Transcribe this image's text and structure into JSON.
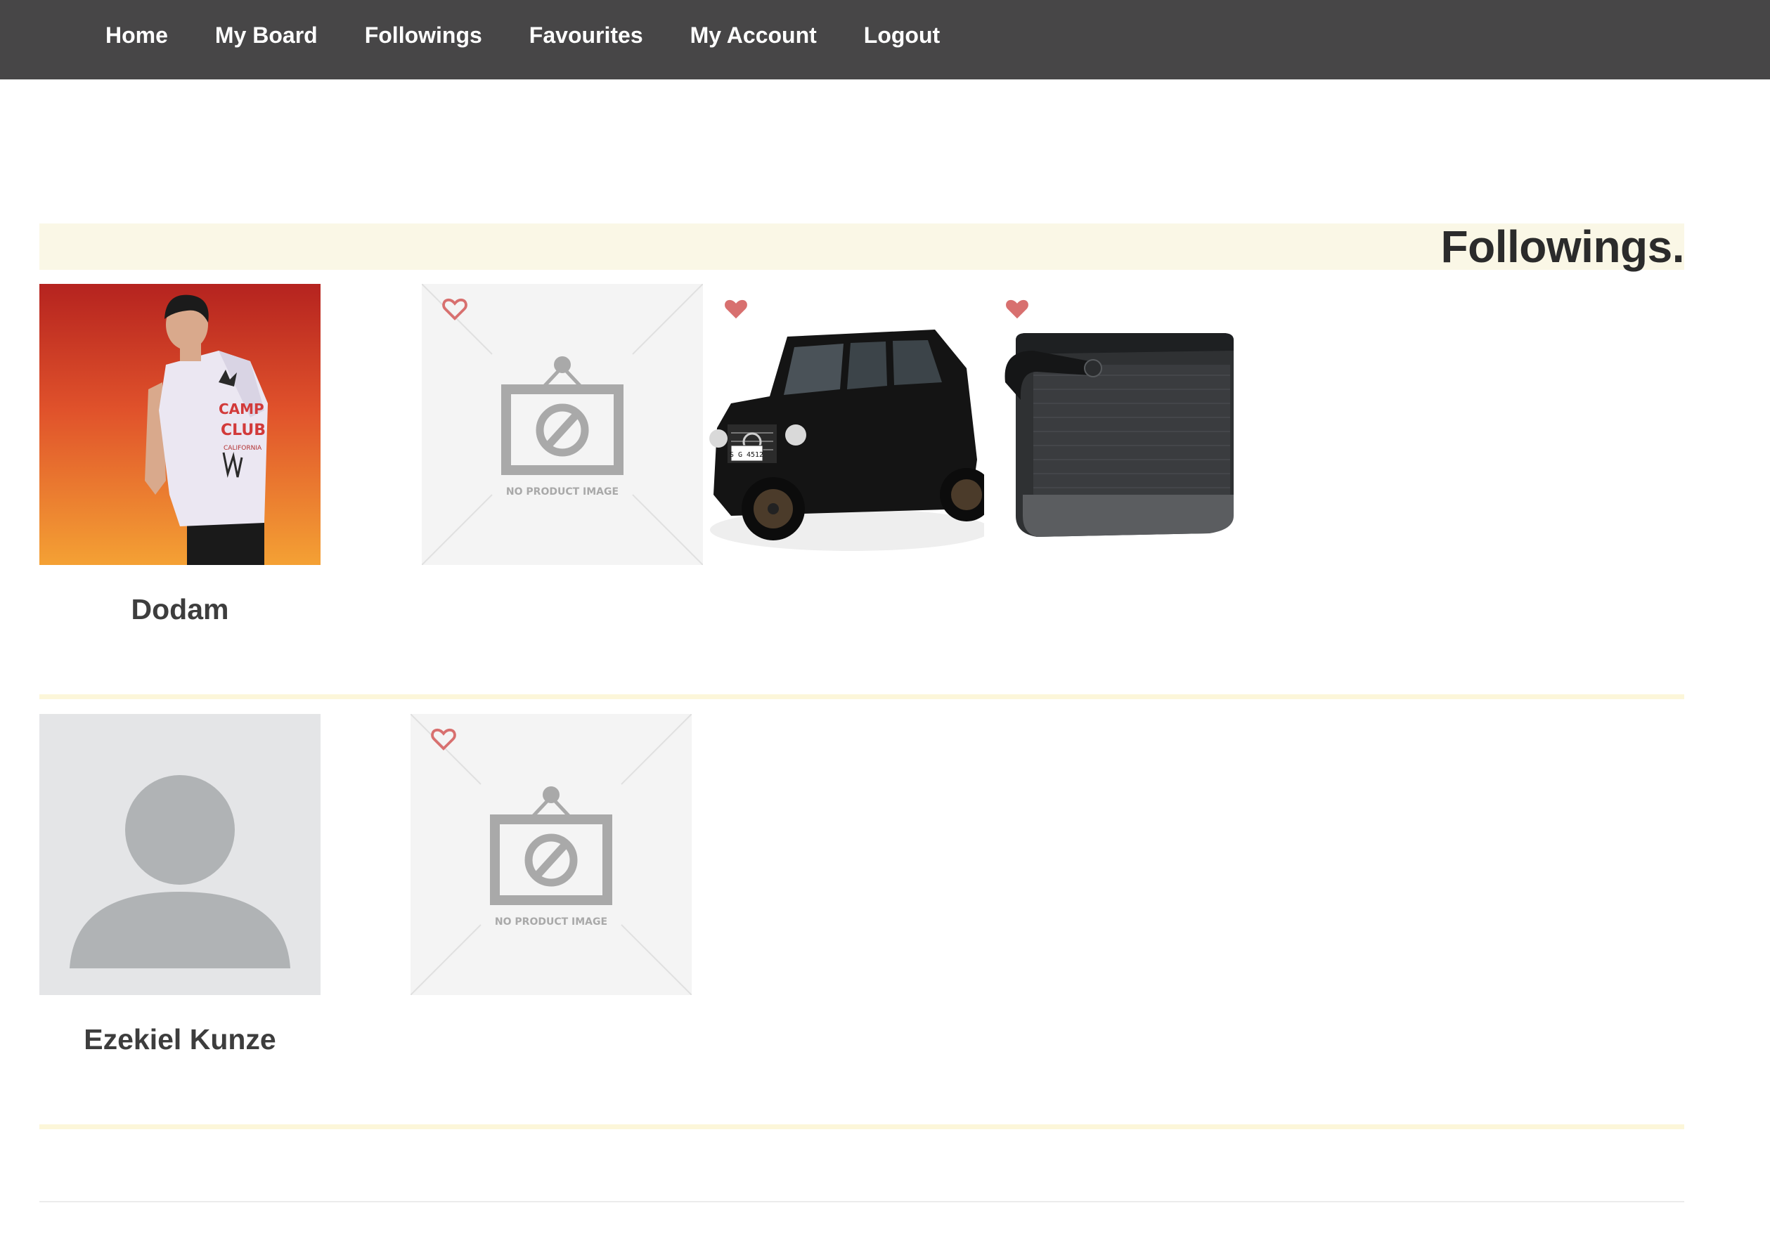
{
  "nav": {
    "items": [
      {
        "label": "Home"
      },
      {
        "label": "My Board"
      },
      {
        "label": "Followings"
      },
      {
        "label": "Favourites"
      },
      {
        "label": "My Account"
      },
      {
        "label": "Logout"
      }
    ],
    "background": "#474647"
  },
  "page": {
    "title": "Followings.",
    "heading_bg": "#faf7e6",
    "divider_color": "#fcf6d9"
  },
  "followings": [
    {
      "name": "Dodam",
      "avatar": "user-photo",
      "products": [
        {
          "image": "no-product-image",
          "placeholder_text": "NO PRODUCT IMAGE",
          "favourite": false,
          "icon": "heart-outline-icon"
        },
        {
          "image": "black-suv",
          "plate_text": "S G 4512",
          "favourite": true,
          "icon": "heart-filled-icon"
        },
        {
          "image": "portable-speaker",
          "favourite": true,
          "icon": "heart-filled-icon"
        }
      ]
    },
    {
      "name": "Ezekiel Kunze",
      "avatar": "default-avatar",
      "products": [
        {
          "image": "no-product-image",
          "placeholder_text": "NO PRODUCT IMAGE",
          "favourite": false,
          "icon": "heart-outline-icon"
        }
      ]
    }
  ],
  "colors": {
    "heart": "#d8706f",
    "placeholder_bg": "#f4f4f4",
    "placeholder_icon": "#a9a9a9",
    "avatar_bg": "#e4e5e7",
    "avatar_fg": "#b0b3b5"
  }
}
